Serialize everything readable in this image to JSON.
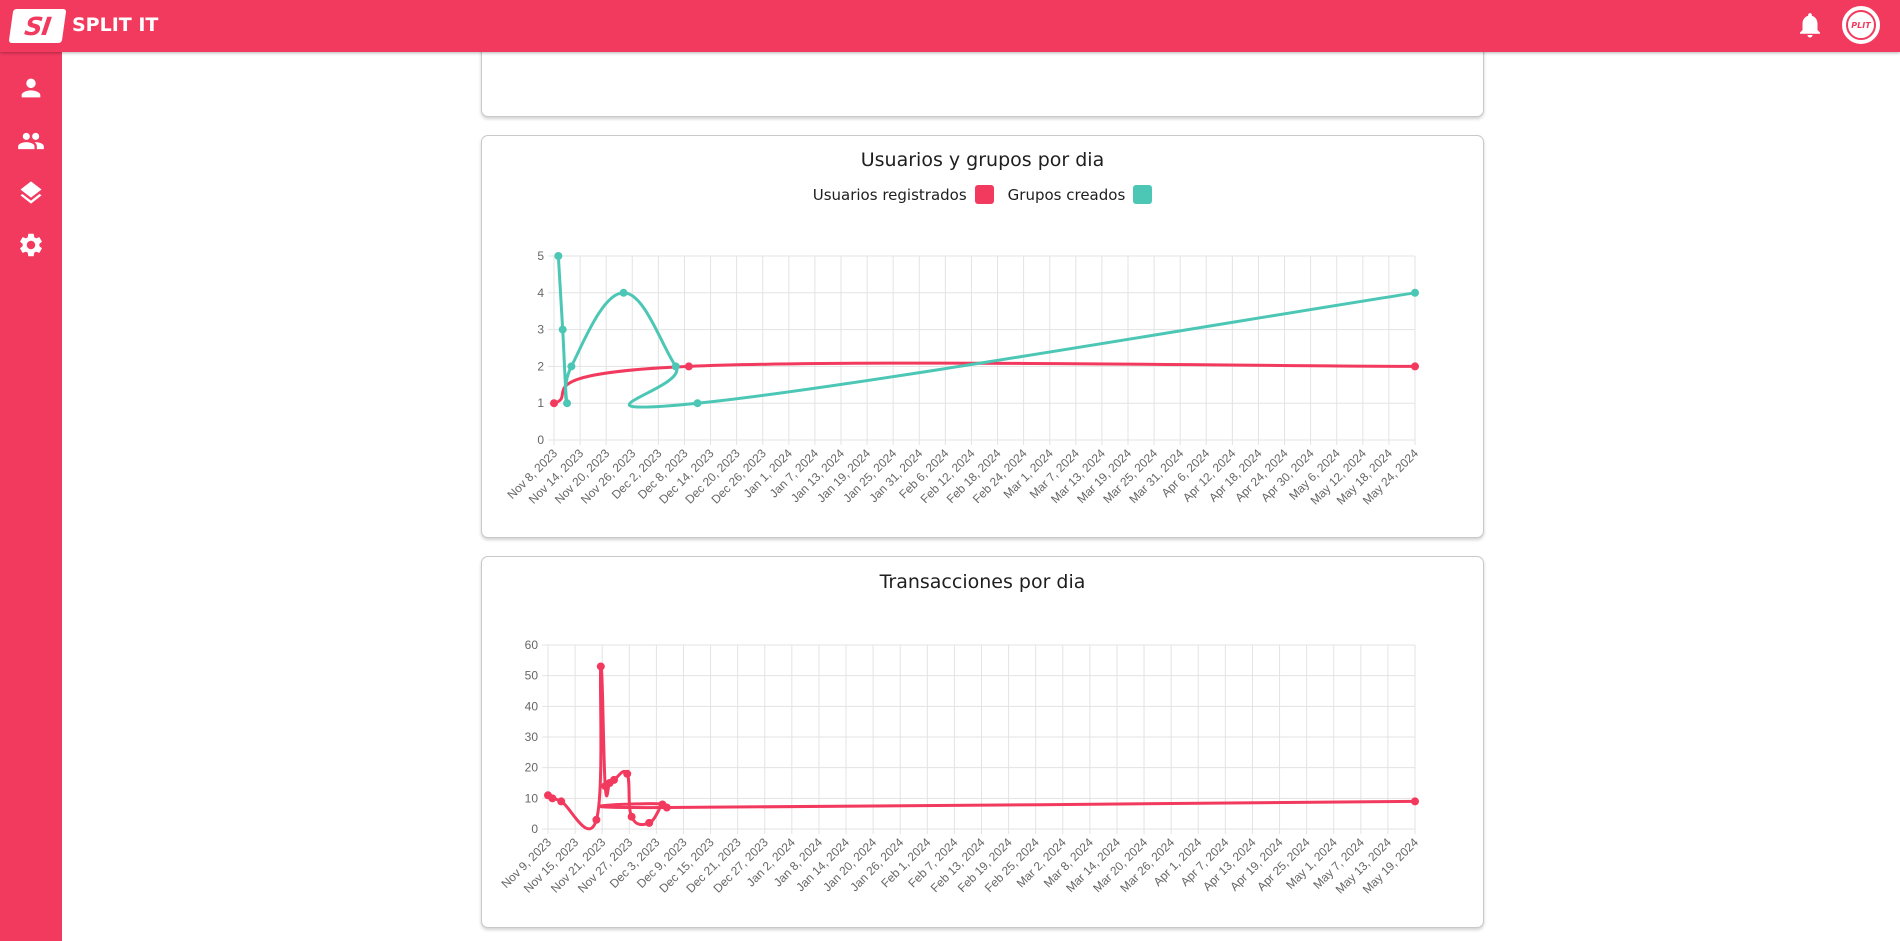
{
  "app": {
    "logo_mark": "SI",
    "name": "SPLIT IT",
    "avatar_text": "PLIT"
  },
  "topbar": {
    "icons": [
      "bell-icon"
    ]
  },
  "sidebar": {
    "items": [
      {
        "icon": "user-icon"
      },
      {
        "icon": "group-icon"
      },
      {
        "icon": "layers-icon"
      },
      {
        "icon": "gear-icon"
      }
    ]
  },
  "colors": {
    "brand": "#f23a5f",
    "series_users": "#f23a5f",
    "series_groups": "#4dc7b5"
  },
  "chart_data": [
    {
      "type": "line",
      "title": "Usuarios y grupos por dia",
      "legend_position": "top",
      "grid": true,
      "ylim": [
        0,
        5
      ],
      "yticks": [
        0,
        1,
        2,
        3,
        4,
        5
      ],
      "x_tick_labels": [
        "Nov 8, 2023",
        "Nov 14, 2023",
        "Nov 20, 2023",
        "Nov 26, 2023",
        "Dec 2, 2023",
        "Dec 8, 2023",
        "Dec 14, 2023",
        "Dec 20, 2023",
        "Dec 26, 2023",
        "Jan 1, 2024",
        "Jan 7, 2024",
        "Jan 13, 2024",
        "Jan 19, 2024",
        "Jan 25, 2024",
        "Jan 31, 2024",
        "Feb 6, 2024",
        "Feb 12, 2024",
        "Feb 18, 2024",
        "Feb 24, 2024",
        "Mar 1, 2024",
        "Mar 7, 2024",
        "Mar 13, 2024",
        "Mar 19, 2024",
        "Mar 25, 2024",
        "Mar 31, 2024",
        "Apr 6, 2024",
        "Apr 12, 2024",
        "Apr 18, 2024",
        "Apr 24, 2024",
        "Apr 30, 2024",
        "May 6, 2024",
        "May 12, 2024",
        "May 18, 2024",
        "May 24, 2024"
      ],
      "x_start": "2023-11-08",
      "x_end": "2024-05-24",
      "series": [
        {
          "name": "Usuarios registrados",
          "color": "#f23a5f",
          "points": [
            [
              "2023-11-08",
              1
            ],
            [
              "2023-12-09",
              2
            ],
            [
              "2024-05-24",
              2
            ]
          ]
        },
        {
          "name": "Grupos creados",
          "color": "#4dc7b5",
          "points": [
            [
              "2023-11-09",
              5
            ],
            [
              "2023-11-10",
              3
            ],
            [
              "2023-11-11",
              1
            ],
            [
              "2023-11-12",
              2
            ],
            [
              "2023-11-24",
              4
            ],
            [
              "2023-12-06",
              2
            ],
            [
              "2023-12-11",
              1
            ],
            [
              "2024-05-24",
              4
            ]
          ]
        }
      ]
    },
    {
      "type": "line",
      "title": "Transacciones por dia",
      "grid": true,
      "ylim": [
        0,
        60
      ],
      "yticks": [
        0,
        10,
        20,
        30,
        40,
        50,
        60
      ],
      "x_tick_labels": [
        "Nov 9, 2023",
        "Nov 15, 2023",
        "Nov 21, 2023",
        "Nov 27, 2023",
        "Dec 3, 2023",
        "Dec 9, 2023",
        "Dec 15, 2023",
        "Dec 21, 2023",
        "Dec 27, 2023",
        "Jan 2, 2024",
        "Jan 8, 2024",
        "Jan 14, 2024",
        "Jan 20, 2024",
        "Jan 26, 2024",
        "Feb 1, 2024",
        "Feb 7, 2024",
        "Feb 13, 2024",
        "Feb 19, 2024",
        "Feb 25, 2024",
        "Mar 2, 2024",
        "Mar 8, 2024",
        "Mar 14, 2024",
        "Mar 20, 2024",
        "Mar 26, 2024",
        "Apr 1, 2024",
        "Apr 7, 2024",
        "Apr 13, 2024",
        "Apr 19, 2024",
        "Apr 25, 2024",
        "May 1, 2024",
        "May 7, 2024",
        "May 13, 2024",
        "May 19, 2024"
      ],
      "x_start": "2023-11-09",
      "x_end": "2024-05-24",
      "series": [
        {
          "color": "#f23a5f",
          "points": [
            [
              "2023-11-09",
              11
            ],
            [
              "2023-11-10",
              10
            ],
            [
              "2023-11-12",
              9
            ],
            [
              "2023-11-20",
              3
            ],
            [
              "2023-11-21",
              53
            ],
            [
              "2023-11-22",
              14
            ],
            [
              "2023-11-23",
              15
            ],
            [
              "2023-11-24",
              16
            ],
            [
              "2023-11-27",
              18
            ],
            [
              "2023-11-28",
              4
            ],
            [
              "2023-12-02",
              2
            ],
            [
              "2023-12-05",
              8
            ],
            [
              "2023-12-06",
              7
            ],
            [
              "2024-05-24",
              9
            ]
          ]
        }
      ]
    }
  ]
}
